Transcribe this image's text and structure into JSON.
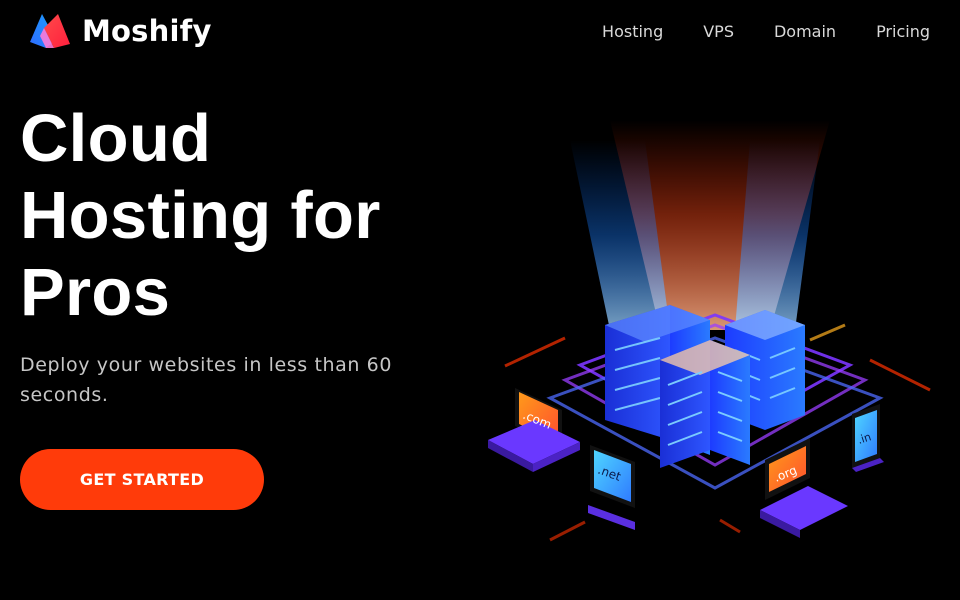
{
  "brand": {
    "name": "Moshify",
    "logo_icon": "moshify-logo-icon",
    "colors": {
      "red": "#ff3b3b",
      "blue": "#2f6bff",
      "pink": "#ff7ad9"
    }
  },
  "nav": {
    "items": [
      {
        "label": "Hosting"
      },
      {
        "label": "VPS"
      },
      {
        "label": "Domain"
      },
      {
        "label": "Pricing"
      }
    ]
  },
  "hero": {
    "title": "Cloud Hosting for Pros",
    "subtitle": "Deploy your websites in less than 60 seconds.",
    "cta_label": "GET STARTED",
    "cta_color": "#ff3b0a"
  },
  "illustration": {
    "icon": "server-cloud-illustration",
    "domains": [
      ".com",
      ".net",
      ".org",
      ".in"
    ]
  }
}
